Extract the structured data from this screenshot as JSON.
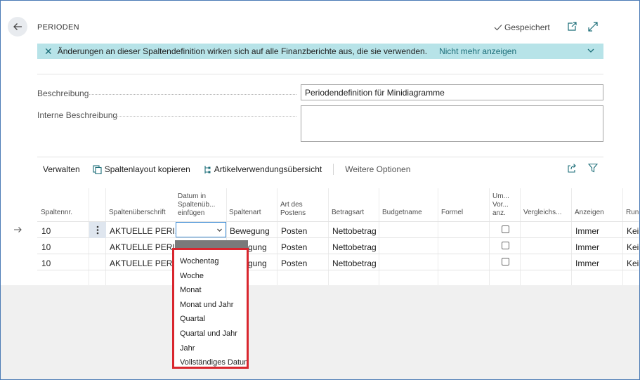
{
  "header": {
    "title": "PERIODEN",
    "saved_label": "Gespeichert"
  },
  "banner": {
    "message": "Änderungen an dieser Spaltendefinition wirken sich auf alle Finanzberichte aus, die sie verwenden.",
    "link": "Nicht mehr anzeigen"
  },
  "fields": {
    "beschreibung_label": "Beschreibung",
    "beschreibung_value": "Periodendefinition für Minidiagramme",
    "interne_label": "Interne Beschreibung",
    "interne_value": ""
  },
  "toolbar": {
    "verwalten": "Verwalten",
    "kopieren": "Spaltenlayout kopieren",
    "artikel": "Artikelverwendungsübersicht",
    "weitere": "Weitere Optionen"
  },
  "grid": {
    "columns": {
      "spaltennr": "Spaltennr.",
      "ueberschrift": "Spaltenüberschrift",
      "datum_1": "Datum in",
      "datum_2": "Spaltenüb...",
      "datum_3": "einfügen",
      "spaltenart": "Spaltenart",
      "art_1": "Art des",
      "art_2": "Postens",
      "betragsart": "Betragsart",
      "budgetname": "Budgetname",
      "formel": "Formel",
      "um_1": "Um...",
      "um_2": "Vor...",
      "um_3": "anz.",
      "vergleich": "Vergleichs...",
      "anzeigen": "Anzeigen",
      "rund": "Run"
    },
    "rows": [
      {
        "nr": "10",
        "ueberschrift": "AKTUELLE PERI...",
        "spaltenart": "Bewegung",
        "art": "Posten",
        "betragsart": "Nettobetrag",
        "anzeigen": "Immer",
        "rund": "Kei"
      },
      {
        "nr": "10",
        "ueberschrift": "AKTUELLE PERI...",
        "spaltenart": "gung",
        "art": "Posten",
        "betragsart": "Nettobetrag",
        "anzeigen": "Immer",
        "rund": "Kei"
      },
      {
        "nr": "10",
        "ueberschrift": "AKTUELLE PERI...",
        "spaltenart": "gung",
        "art": "Posten",
        "betragsart": "Nettobetrag",
        "anzeigen": "Immer",
        "rund": "Kei"
      }
    ]
  },
  "dropdown": {
    "options": [
      "Wochentag",
      "Woche",
      "Monat",
      "Monat und Jahr",
      "Quartal",
      "Quartal und Jahr",
      "Jahr",
      "Vollständiges Datum"
    ]
  },
  "colors": {
    "banner_bg": "#b7e3e8",
    "accent": "#1b6d78",
    "highlight_border": "#d9262e",
    "focus_border": "#3b8bd4"
  }
}
